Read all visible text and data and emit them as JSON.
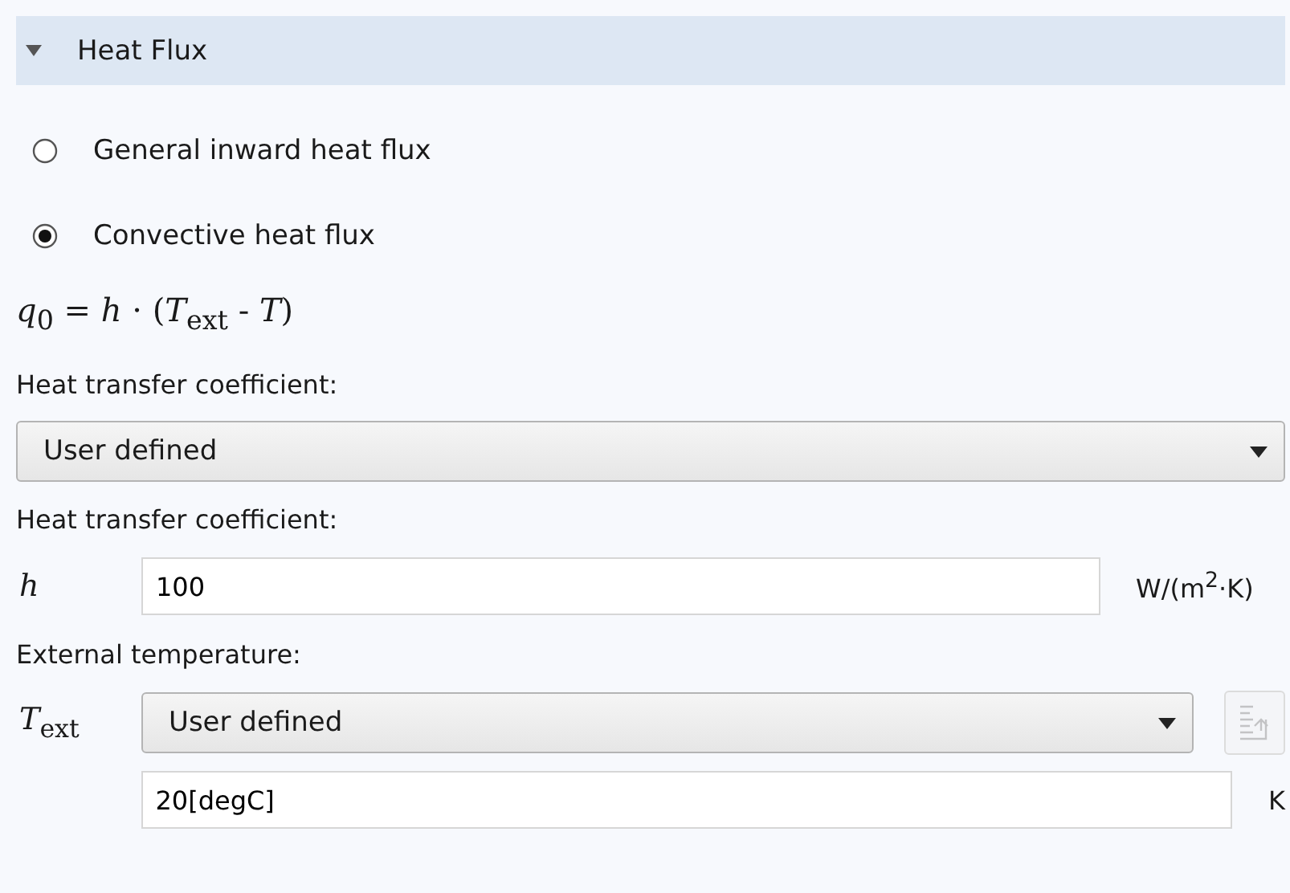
{
  "section": {
    "title": "Heat Flux",
    "expanded": true
  },
  "options": [
    {
      "label": "General inward heat flux",
      "selected": false
    },
    {
      "label": "Convective heat flux",
      "selected": true
    }
  ],
  "formula": "*q*$_{0}$ = *h* · (*T*$_{ext}$ - *T*)",
  "coefficient_method": {
    "label": "Heat transfer coefficient:",
    "value": "User defined"
  },
  "coefficient": {
    "label": "Heat transfer coefficient:",
    "symbol": "*h*",
    "value": "100",
    "unit": "W/(m$^{2}$·K)"
  },
  "external_temperature": {
    "label": "External temperature:",
    "symbol": "*T*$_{ext}$",
    "method": "User defined",
    "value": "20[degC]",
    "unit": "K",
    "button": {
      "disabled": true
    }
  }
}
